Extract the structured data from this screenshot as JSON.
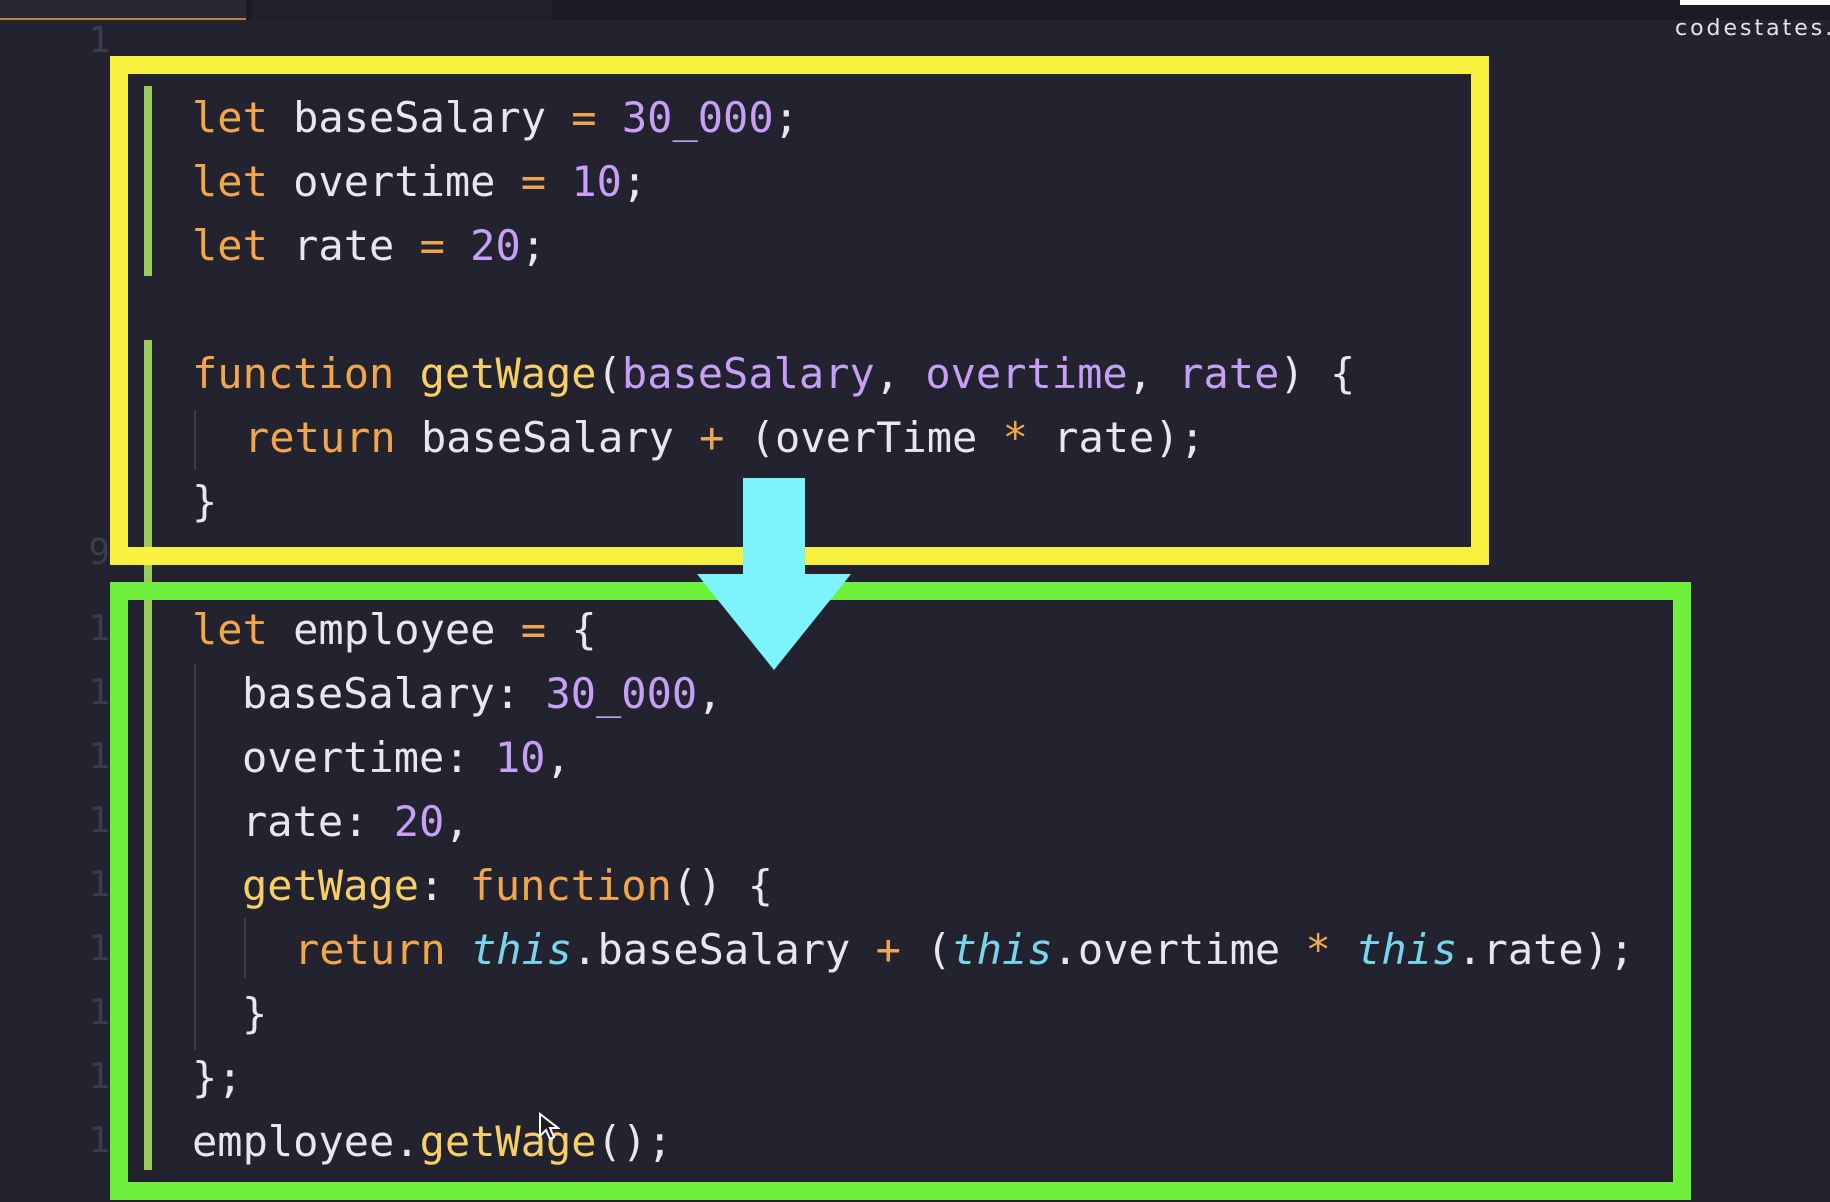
{
  "watermark": "codestates.",
  "line_numbers": [
    "1",
    "9",
    "1",
    "1",
    "1",
    "1",
    "1",
    "1",
    "1",
    "1",
    "1"
  ],
  "code": {
    "line1": {
      "kw": "let",
      "name": " baseSalary ",
      "op": "=",
      "sp": " ",
      "num": "30_000",
      "end": ";"
    },
    "line2": {
      "kw": "let",
      "name": " overtime ",
      "op": "=",
      "sp": " ",
      "num": "10",
      "end": ";"
    },
    "line3": {
      "kw": "let",
      "name": " rate ",
      "op": "=",
      "sp": " ",
      "num": "20",
      "end": ";"
    },
    "line5": {
      "kw": "function",
      "sp1": " ",
      "fn": "getWage",
      "open": "(",
      "p1": "baseSalary",
      "c1": ", ",
      "p2": "overtime",
      "c2": ", ",
      "p3": "rate",
      "close": ") {"
    },
    "line6": {
      "kw": "return",
      "a": " baseSalary ",
      "op1": "+",
      "b": " (overTime ",
      "op2": "*",
      "c": " rate);"
    },
    "line7": "}",
    "line10": {
      "kw": "let",
      "name": " employee ",
      "op": "=",
      "rest": " {"
    },
    "line11": {
      "key": "baseSalary: ",
      "num": "30_000",
      "end": ","
    },
    "line12": {
      "key": "overtime: ",
      "num": "10",
      "end": ","
    },
    "line13": {
      "key": "rate: ",
      "num": "20",
      "end": ","
    },
    "line14": {
      "fn": "getWage",
      "colon": ": ",
      "kw": "function",
      "rest": "() {"
    },
    "line15": {
      "kw": "return",
      "sp": " ",
      "t1": "this",
      "a": ".baseSalary ",
      "op1": "+",
      "b": " (",
      "t2": "this",
      "c": ".overtime ",
      "op2": "*",
      "d": " ",
      "t3": "this",
      "e": ".rate);"
    },
    "line16": "}",
    "line17": "};",
    "line18": {
      "obj": "employee.",
      "fn": "getWage",
      "rest": "();"
    }
  },
  "annotations": {
    "top_box_color": "#f8f23f",
    "bottom_box_color": "#6ef03c",
    "arrow_color": "#7df4fb",
    "arrow_direction": "down"
  }
}
